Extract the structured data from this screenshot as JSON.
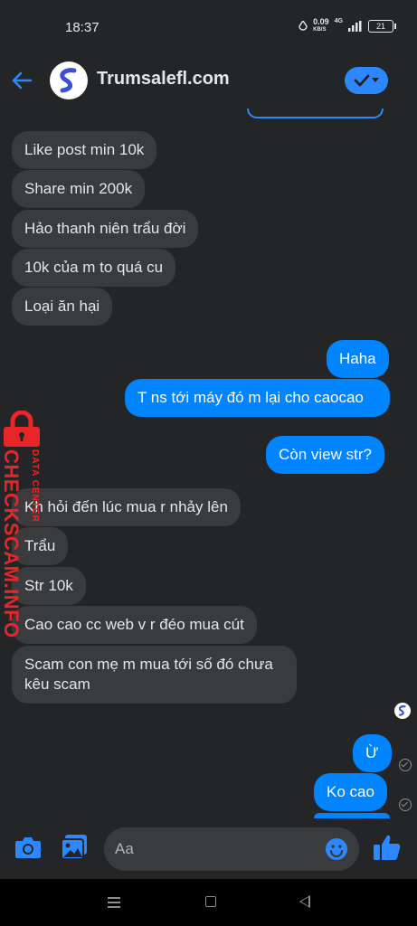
{
  "status_bar": {
    "time": "18:37",
    "net_speed_value": "0.09",
    "net_speed_unit": "KB/S",
    "network": "4G",
    "battery": "21"
  },
  "header": {
    "title": "Trumsalefl.com",
    "accent_color": "#2d88ff"
  },
  "messages": [
    {
      "side": "in",
      "text": "Like post min 10k"
    },
    {
      "side": "in",
      "text": "Share min 200k"
    },
    {
      "side": "in",
      "text": "Hảo thanh niên trẩu đời"
    },
    {
      "side": "in",
      "text": "10k của m to quá cu"
    },
    {
      "side": "in",
      "text": "Loại ăn hại"
    },
    {
      "side": "out",
      "text": "Haha"
    },
    {
      "side": "out",
      "text": "T ns tới máy đó m lại cho caocao"
    },
    {
      "side": "out",
      "text": "Còn view str?"
    },
    {
      "side": "in",
      "text": "Kh hỏi đến lúc mua r nhảy lên"
    },
    {
      "side": "in",
      "text": "Trẩu"
    },
    {
      "side": "in",
      "text": "Str 10k"
    },
    {
      "side": "in",
      "text": "Cao cao cc web v r đéo mua cút"
    },
    {
      "side": "in",
      "text": "Scam con mẹ m mua tới số đó chưa kêu scam"
    },
    {
      "side": "out",
      "text": "Ừ"
    },
    {
      "side": "out",
      "text": "Ko cao"
    }
  ],
  "watermark": {
    "main": "CHECKSCAM.INFO",
    "sub": "DATA CENTER"
  },
  "composer": {
    "placeholder": "Aa"
  },
  "icons": [
    "back-arrow-icon",
    "checkmark-dropdown-icon",
    "camera-icon",
    "gallery-icon",
    "emoji-icon",
    "thumbs-up-icon",
    "read-receipt-icon"
  ],
  "colors": {
    "outgoing_bubble": "#0084ff",
    "incoming_bubble": "#3a3b3c",
    "background": "#242526",
    "watermark": "#e8262a"
  }
}
